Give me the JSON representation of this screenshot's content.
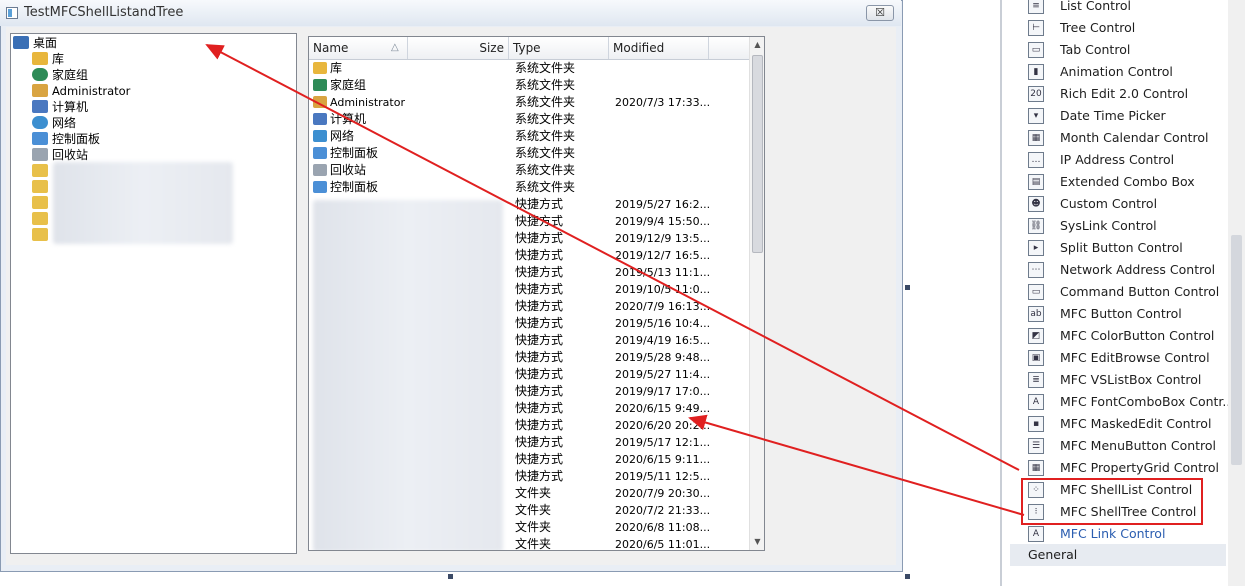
{
  "window": {
    "title": "TestMFCShellListandTree",
    "close_glyph": "☒"
  },
  "tree": {
    "items": [
      {
        "label": "桌面",
        "icon": "desktop-icon",
        "color": "#3a6fb5"
      },
      {
        "label": "库",
        "icon": "library-icon",
        "color": "#e8b63c"
      },
      {
        "label": "家庭组",
        "icon": "homegroup-icon",
        "color": "#2e8b57"
      },
      {
        "label": "Administrator",
        "icon": "user-folder-icon",
        "color": "#d9a441"
      },
      {
        "label": "计算机",
        "icon": "computer-icon",
        "color": "#4a78c0"
      },
      {
        "label": "网络",
        "icon": "network-icon",
        "color": "#3c8fd0"
      },
      {
        "label": "控制面板",
        "icon": "control-panel-icon",
        "color": "#4b8fd6"
      },
      {
        "label": "回收站",
        "icon": "recycle-bin-icon",
        "color": "#9aa4b0"
      }
    ]
  },
  "list": {
    "columns": {
      "name": "Name",
      "size": "Size",
      "type": "Type",
      "modified": "Modified"
    },
    "rows": [
      {
        "name": "库",
        "type": "系统文件夹",
        "modified": ""
      },
      {
        "name": "家庭组",
        "type": "系统文件夹",
        "modified": ""
      },
      {
        "name": "Administrator",
        "type": "系统文件夹",
        "modified": "2020/7/3 17:33..."
      },
      {
        "name": "计算机",
        "type": "系统文件夹",
        "modified": ""
      },
      {
        "name": "网络",
        "type": "系统文件夹",
        "modified": ""
      },
      {
        "name": "控制面板",
        "type": "系统文件夹",
        "modified": ""
      },
      {
        "name": "回收站",
        "type": "系统文件夹",
        "modified": ""
      },
      {
        "name": "控制面板",
        "type": "系统文件夹",
        "modified": ""
      },
      {
        "name": "",
        "type": "快捷方式",
        "modified": "2019/5/27 16:2..."
      },
      {
        "name": "",
        "type": "快捷方式",
        "modified": "2019/9/4 15:50..."
      },
      {
        "name": "",
        "type": "快捷方式",
        "modified": "2019/12/9 13:5..."
      },
      {
        "name": "",
        "type": "快捷方式",
        "modified": "2019/12/7 16:5..."
      },
      {
        "name": "",
        "type": "快捷方式",
        "modified": "2019/5/13 11:1..."
      },
      {
        "name": "",
        "type": "快捷方式",
        "modified": "2019/10/5 11:0..."
      },
      {
        "name": "",
        "type": "快捷方式",
        "modified": "2020/7/9 16:13..."
      },
      {
        "name": "",
        "type": "快捷方式",
        "modified": "2019/5/16 10:4..."
      },
      {
        "name": "",
        "type": "快捷方式",
        "modified": "2019/4/19 16:5..."
      },
      {
        "name": "",
        "type": "快捷方式",
        "modified": "2019/5/28 9:48..."
      },
      {
        "name": "",
        "type": "快捷方式",
        "modified": "2019/5/27 11:4..."
      },
      {
        "name": "",
        "type": "快捷方式",
        "modified": "2019/9/17 17:0..."
      },
      {
        "name": "",
        "type": "快捷方式",
        "modified": "2020/6/15 9:49..."
      },
      {
        "name": "",
        "type": "快捷方式",
        "modified": "2020/6/20 20:2..."
      },
      {
        "name": "",
        "type": "快捷方式",
        "modified": "2019/5/17 12:1..."
      },
      {
        "name": "",
        "type": "快捷方式",
        "modified": "2020/6/15 9:11..."
      },
      {
        "name": "",
        "type": "快捷方式",
        "modified": "2019/5/11 12:5..."
      },
      {
        "name": "",
        "type": "文件夹",
        "modified": "2020/7/9 20:30..."
      },
      {
        "name": "",
        "type": "文件夹",
        "modified": "2020/7/2 21:33..."
      },
      {
        "name": "",
        "type": "文件夹",
        "modified": "2020/6/8 11:08..."
      },
      {
        "name": "",
        "type": "文件夹",
        "modified": "2020/6/5 11:01..."
      }
    ]
  },
  "toolbox": {
    "items": [
      {
        "label": "List Control",
        "icon": "list-control-icon",
        "glyph": "≡"
      },
      {
        "label": "Tree Control",
        "icon": "tree-control-icon",
        "glyph": "⊢"
      },
      {
        "label": "Tab Control",
        "icon": "tab-control-icon",
        "glyph": "▭"
      },
      {
        "label": "Animation Control",
        "icon": "animation-control-icon",
        "glyph": "▮"
      },
      {
        "label": "Rich Edit 2.0 Control",
        "icon": "rich-edit-icon",
        "glyph": "20"
      },
      {
        "label": "Date Time Picker",
        "icon": "date-time-picker-icon",
        "glyph": "▾"
      },
      {
        "label": "Month Calendar Control",
        "icon": "month-calendar-icon",
        "glyph": "▦"
      },
      {
        "label": "IP Address Control",
        "icon": "ip-address-icon",
        "glyph": "…"
      },
      {
        "label": "Extended Combo Box",
        "icon": "extended-combo-icon",
        "glyph": "▤"
      },
      {
        "label": "Custom Control",
        "icon": "custom-control-icon",
        "glyph": "☻"
      },
      {
        "label": "SysLink Control",
        "icon": "syslink-icon",
        "glyph": "⛓"
      },
      {
        "label": "Split Button Control",
        "icon": "split-button-icon",
        "glyph": "▸"
      },
      {
        "label": "Network Address Control",
        "icon": "network-address-icon",
        "glyph": "⋯"
      },
      {
        "label": "Command Button Control",
        "icon": "command-button-icon",
        "glyph": "▭"
      },
      {
        "label": "MFC Button Control",
        "icon": "mfc-button-icon",
        "glyph": "ab"
      },
      {
        "label": "MFC ColorButton Control",
        "icon": "mfc-colorbutton-icon",
        "glyph": "◩"
      },
      {
        "label": "MFC EditBrowse Control",
        "icon": "mfc-editbrowse-icon",
        "glyph": "▣"
      },
      {
        "label": "MFC VSListBox Control",
        "icon": "mfc-vslistbox-icon",
        "glyph": "≣"
      },
      {
        "label": "MFC FontComboBox Contr...",
        "icon": "mfc-fontcombobox-icon",
        "glyph": "A"
      },
      {
        "label": "MFC MaskedEdit Control",
        "icon": "mfc-maskededit-icon",
        "glyph": "▪"
      },
      {
        "label": "MFC MenuButton Control",
        "icon": "mfc-menubutton-icon",
        "glyph": "☰"
      },
      {
        "label": "MFC PropertyGrid Control",
        "icon": "mfc-propertygrid-icon",
        "glyph": "▦"
      },
      {
        "label": "MFC ShellList Control",
        "icon": "mfc-shelllist-icon",
        "glyph": "⁘"
      },
      {
        "label": "MFC ShellTree Control",
        "icon": "mfc-shelltree-icon",
        "glyph": "⁝"
      },
      {
        "label": "MFC Link Control",
        "icon": "mfc-link-icon",
        "glyph": "A"
      }
    ],
    "group_label": "General",
    "group_arrow": "◢"
  },
  "colors": {
    "annotation_red": "#e02020",
    "link_blue": "#2a5db0"
  }
}
